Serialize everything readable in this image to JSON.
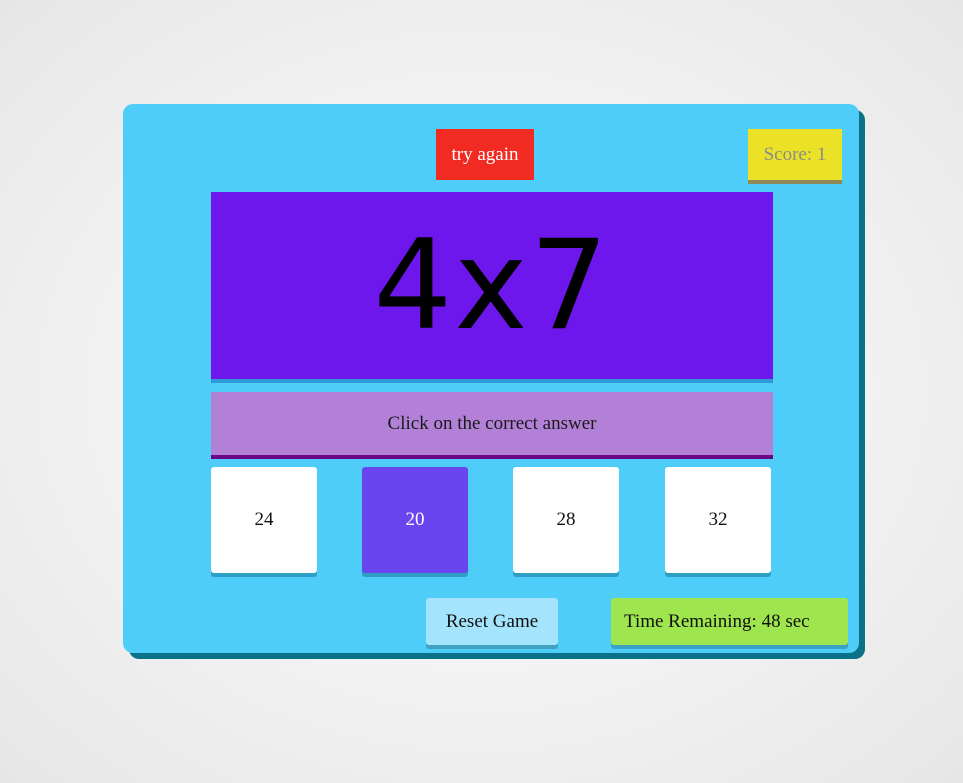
{
  "feedback": {
    "text": "try again",
    "color": "#f12a22"
  },
  "score": {
    "label": "Score: ",
    "value": "1"
  },
  "question": {
    "text": "4x7"
  },
  "instruction": {
    "text": "Click on the correct answer"
  },
  "choices": [
    {
      "label": "24",
      "selected": false
    },
    {
      "label": "20",
      "selected": true
    },
    {
      "label": "28",
      "selected": false
    },
    {
      "label": "32",
      "selected": false
    }
  ],
  "reset": {
    "label": "Reset Game"
  },
  "timer": {
    "label": "Time Remaining: ",
    "value": "48",
    "unit": " sec"
  },
  "colors": {
    "container": "#4dcdf8",
    "question_bg": "#6d17ec",
    "instruction_bg": "#b281d7",
    "selected_choice": "#6845ee",
    "score_bg": "#ebe227",
    "timer_bg": "#9fe64e",
    "reset_bg": "#a5e4fd"
  }
}
